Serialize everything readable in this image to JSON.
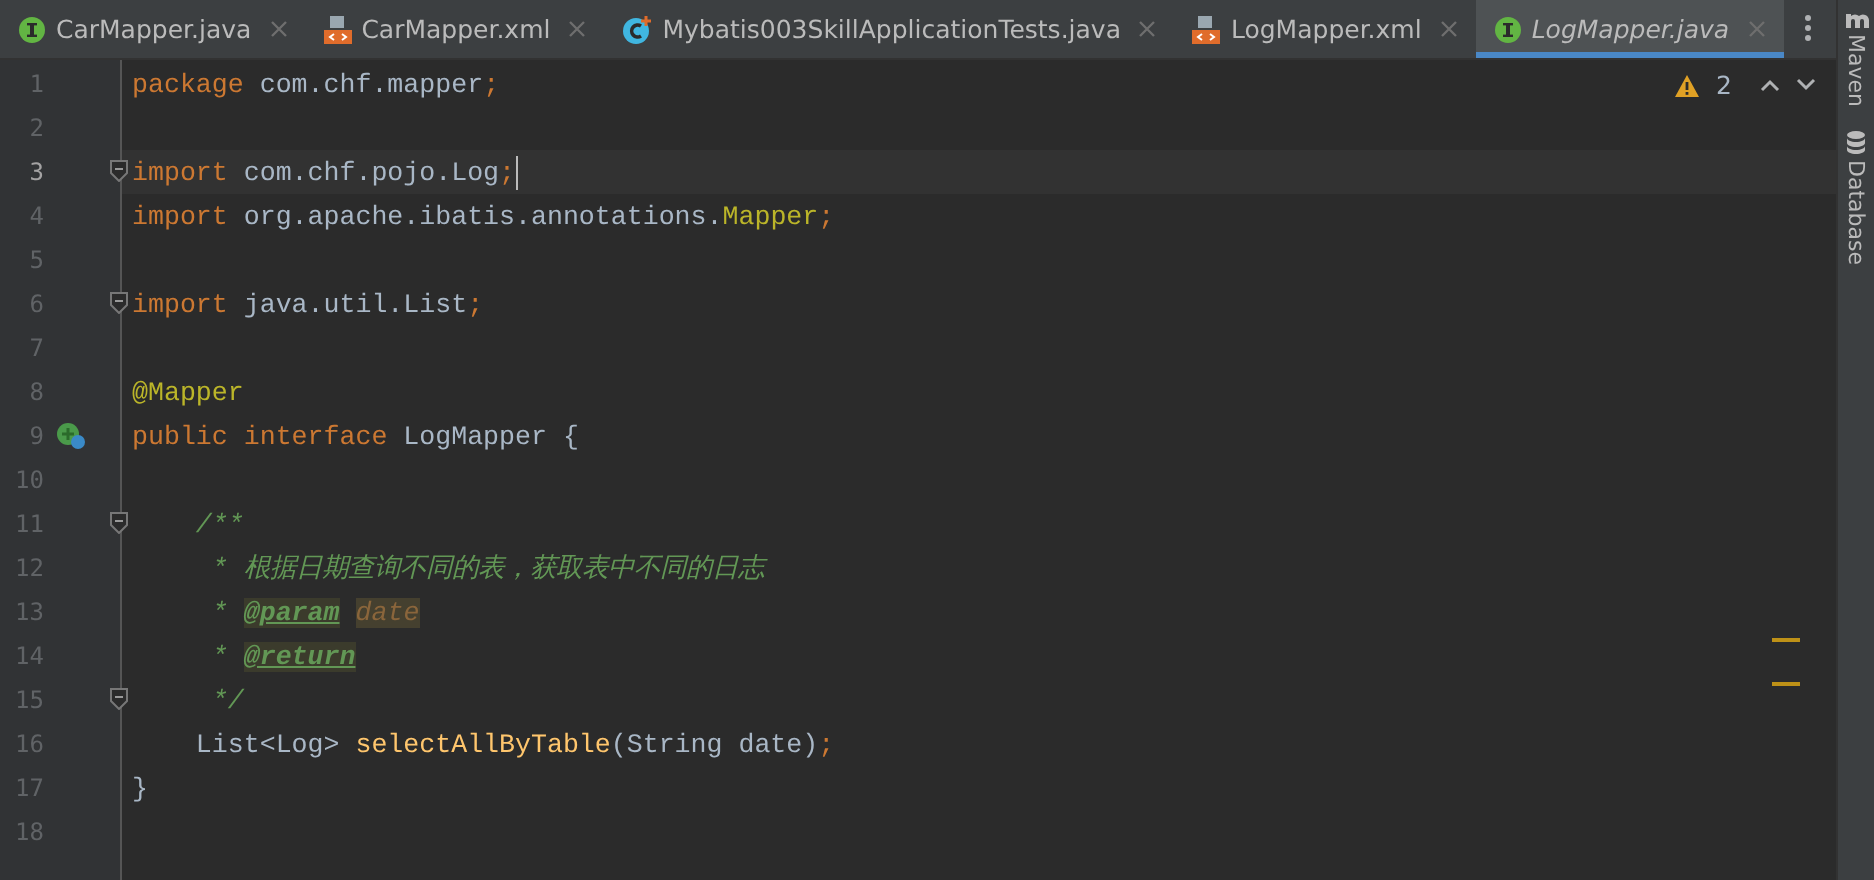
{
  "tabs": [
    {
      "label": "CarMapper.java",
      "kind": "interface",
      "selected": false
    },
    {
      "label": "CarMapper.xml",
      "kind": "xml",
      "selected": false
    },
    {
      "label": "Mybatis003SkillApplicationTests.java",
      "kind": "class",
      "selected": false
    },
    {
      "label": "LogMapper.xml",
      "kind": "xml",
      "selected": false
    },
    {
      "label": "LogMapper.java",
      "kind": "interface",
      "selected": true
    }
  ],
  "inspections": {
    "warning_count": "2"
  },
  "side_tools": [
    {
      "label": "Maven",
      "kind": "maven"
    },
    {
      "label": "Database",
      "kind": "database"
    }
  ],
  "lines": [
    {
      "number": "1",
      "current": false,
      "fold": false,
      "tokens": [
        {
          "text": "package ",
          "kind": "keyword"
        },
        {
          "text": "com.chf.mapper",
          "kind": "plain"
        },
        {
          "text": ";",
          "kind": "keyword"
        }
      ]
    },
    {
      "number": "2",
      "current": false,
      "fold": false
    },
    {
      "number": "3",
      "current": true,
      "fold": true,
      "tokens": [
        {
          "text": "import ",
          "kind": "keyword"
        },
        {
          "text": "com.chf.pojo.Log",
          "kind": "plain"
        },
        {
          "text": ";",
          "kind": "keyword"
        }
      ]
    },
    {
      "number": "4",
      "current": false,
      "fold": false,
      "tokens": [
        {
          "text": "import ",
          "kind": "keyword"
        },
        {
          "text": "org.apache.ibatis.annotations.",
          "kind": "plain"
        },
        {
          "text": "Mapper",
          "kind": "annotation"
        },
        {
          "text": ";",
          "kind": "keyword"
        }
      ]
    },
    {
      "number": "5",
      "current": false,
      "fold": false
    },
    {
      "number": "6",
      "current": false,
      "fold": true,
      "tokens": [
        {
          "text": "import ",
          "kind": "keyword"
        },
        {
          "text": "java.util.List",
          "kind": "plain"
        },
        {
          "text": ";",
          "kind": "keyword"
        }
      ]
    },
    {
      "number": "7",
      "current": false,
      "fold": false
    },
    {
      "number": "8",
      "current": false,
      "fold": false,
      "tokens": [
        {
          "text": "@Mapper",
          "kind": "annotation"
        }
      ]
    },
    {
      "number": "9",
      "current": false,
      "fold": false,
      "implemented": true,
      "tokens": [
        {
          "text": "public interface ",
          "kind": "keyword"
        },
        {
          "text": "LogMapper {",
          "kind": "plain"
        }
      ]
    },
    {
      "number": "10",
      "current": false,
      "fold": false
    },
    {
      "number": "11",
      "current": false,
      "fold": true,
      "tokens": [
        {
          "text": "    /**",
          "kind": "doc"
        }
      ]
    },
    {
      "number": "12",
      "current": false,
      "fold": false,
      "tokens": [
        {
          "text": "     * 根据日期查询不同的表，获取表中不同的日志",
          "kind": "doc"
        }
      ]
    },
    {
      "number": "13",
      "current": false,
      "fold": false,
      "tokens": [
        {
          "text": "     * ",
          "kind": "doc"
        },
        {
          "text": "@param",
          "kind": "doc_tag"
        },
        {
          "text": "date",
          "kind": "doc_value"
        }
      ]
    },
    {
      "number": "14",
      "current": false,
      "fold": false,
      "tokens": [
        {
          "text": "     * ",
          "kind": "doc"
        },
        {
          "text": "@return",
          "kind": "doc_tag"
        }
      ]
    },
    {
      "number": "15",
      "current": false,
      "fold": true,
      "tokens": [
        {
          "text": "     */",
          "kind": "doc"
        }
      ]
    },
    {
      "number": "16",
      "current": false,
      "fold": false,
      "tokens": [
        {
          "text": "    List<Log> ",
          "kind": "plain"
        },
        {
          "text": "selectAllByTable",
          "kind": "method"
        },
        {
          "text": "(String date)",
          "kind": "plain"
        },
        {
          "text": ";",
          "kind": "keyword"
        }
      ]
    },
    {
      "number": "17",
      "current": false,
      "fold": false,
      "tokens": [
        {
          "text": "}",
          "kind": "plain"
        }
      ]
    },
    {
      "number": "18",
      "current": false,
      "fold": false
    }
  ],
  "stripe_marks": [
    {
      "color": "#be9117"
    },
    {
      "color": "#be9117"
    }
  ]
}
